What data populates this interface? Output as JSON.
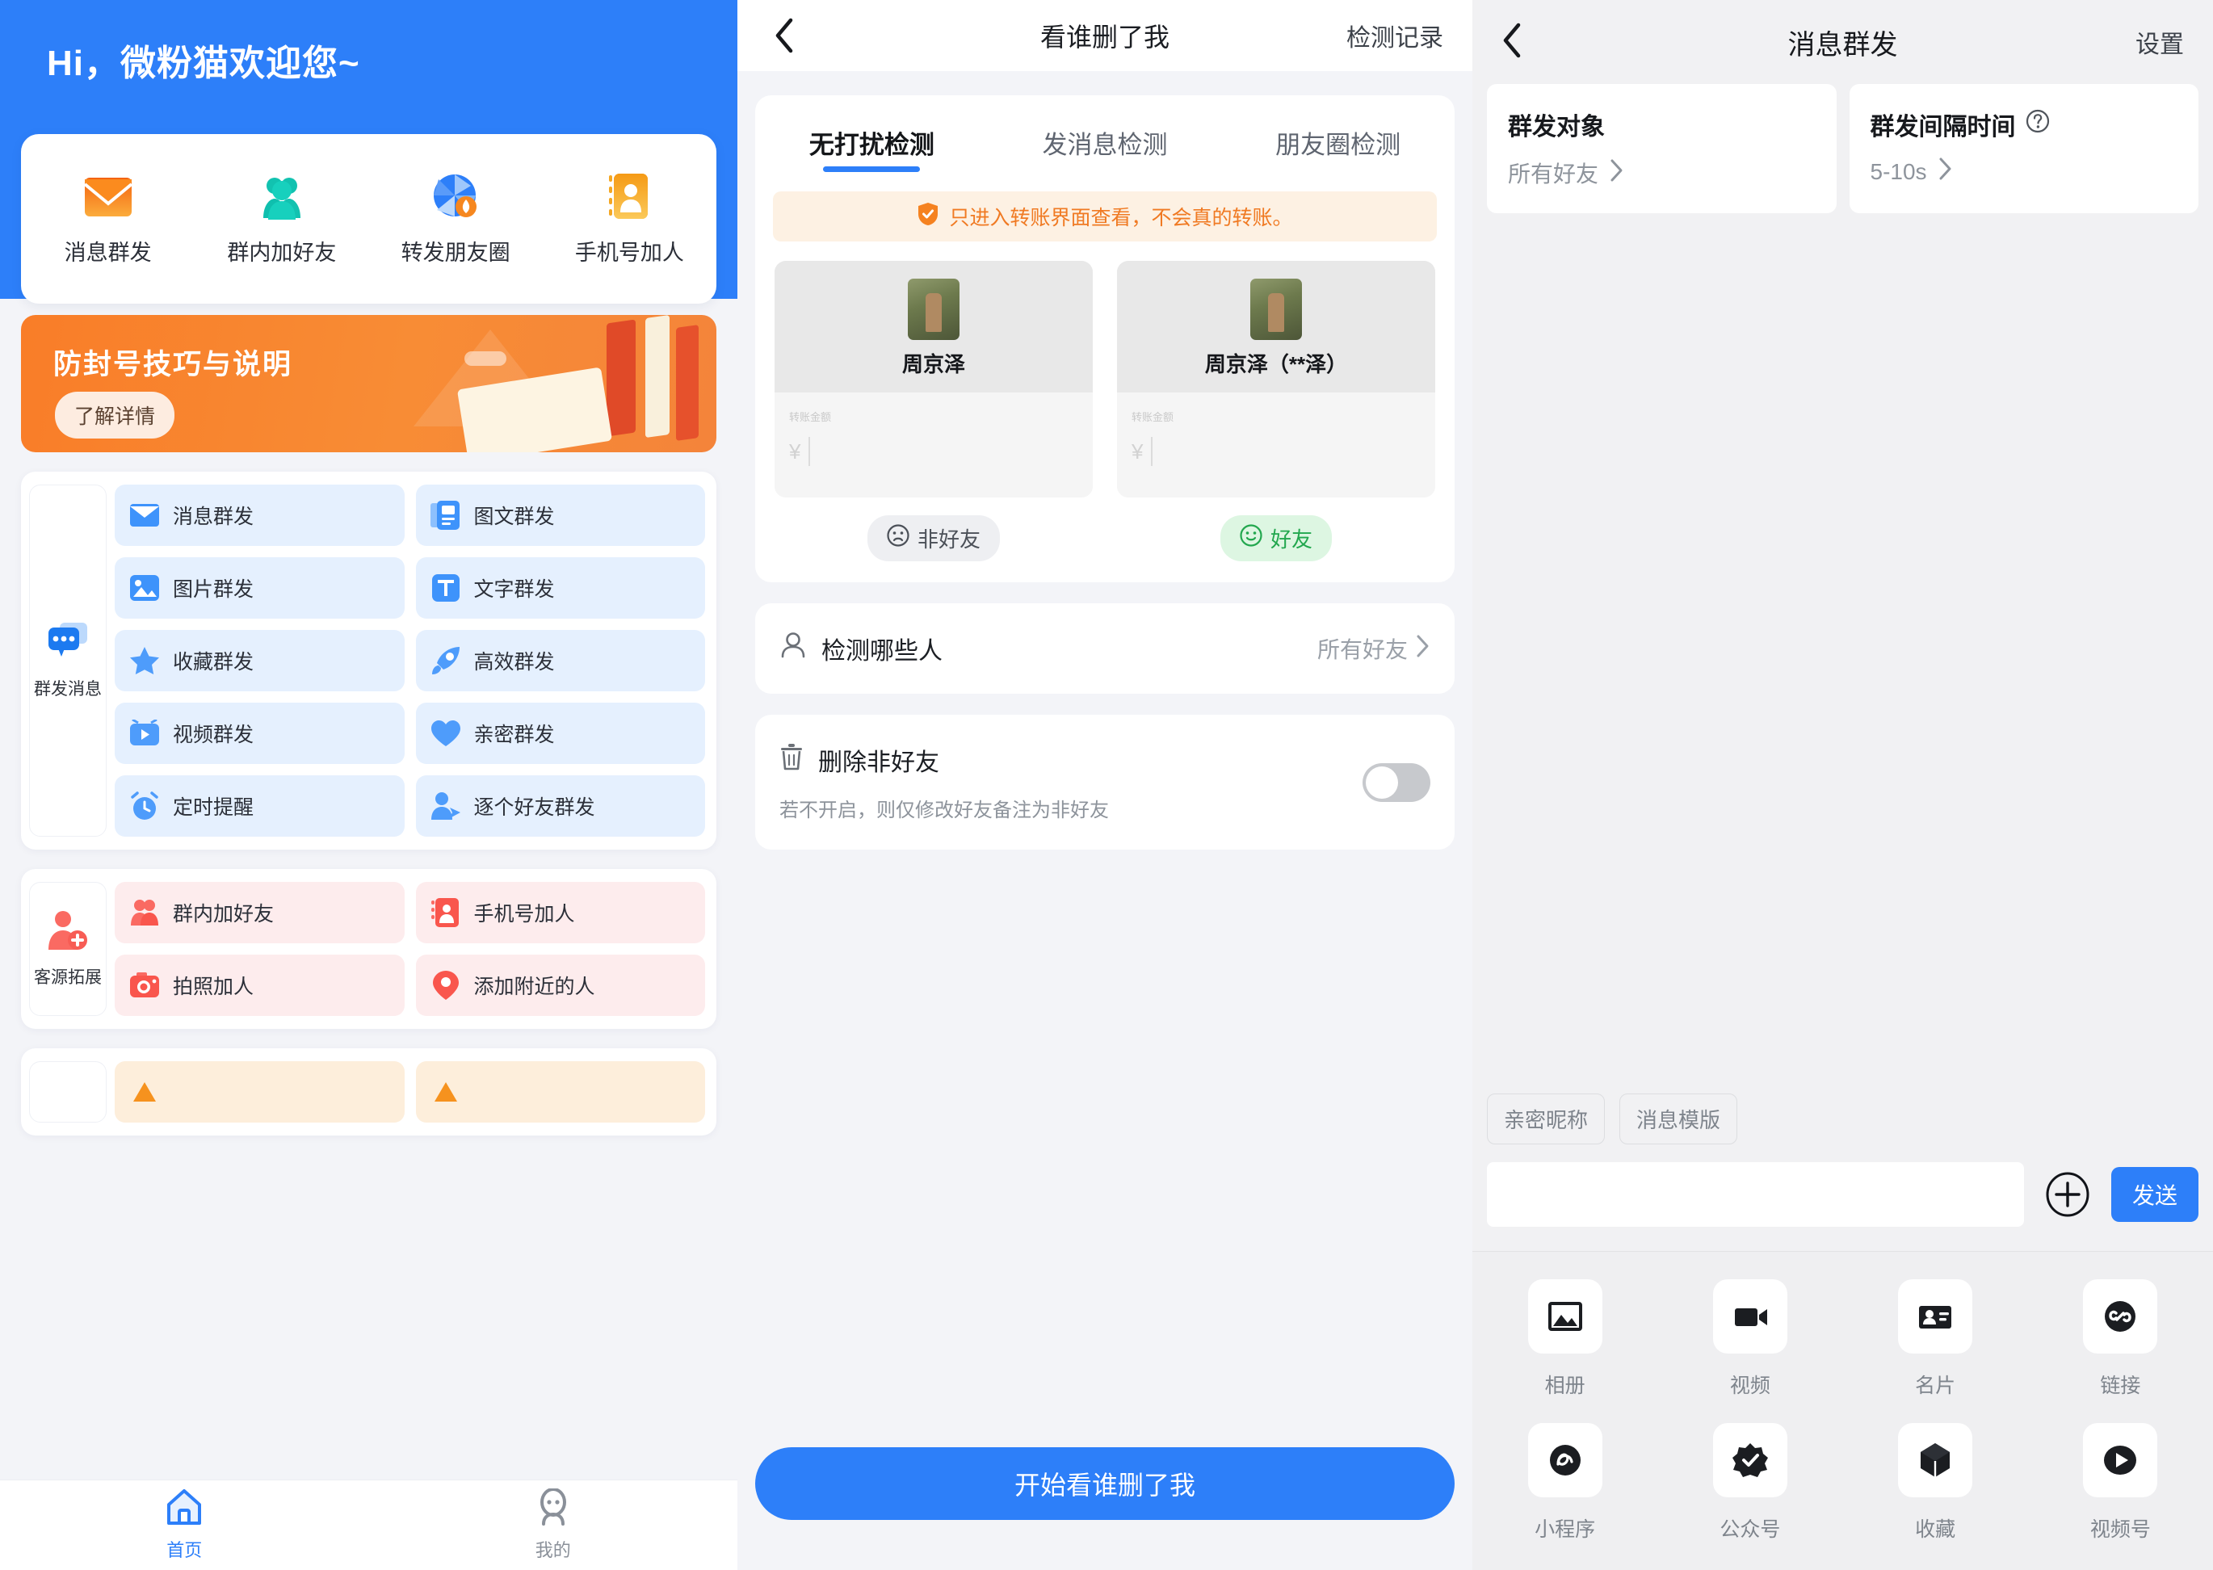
{
  "panel1": {
    "greeting": "Hi，微粉猫欢迎您~",
    "quick_actions": [
      {
        "label": "消息群发",
        "icon": "envelope-icon"
      },
      {
        "label": "群内加好友",
        "icon": "group-people-icon"
      },
      {
        "label": "转发朋友圈",
        "icon": "aperture-icon"
      },
      {
        "label": "手机号加人",
        "icon": "contact-book-icon"
      }
    ],
    "banner": {
      "title": "防封号技巧与说明",
      "button": "了解详情"
    },
    "sections": [
      {
        "side_label": "群发消息",
        "side_icon": "chat-bubbles-icon",
        "theme": "blue",
        "items": [
          {
            "label": "消息群发",
            "icon": "envelope-icon"
          },
          {
            "label": "图文群发",
            "icon": "image-text-icon"
          },
          {
            "label": "图片群发",
            "icon": "picture-icon"
          },
          {
            "label": "文字群发",
            "icon": "text-t-icon"
          },
          {
            "label": "收藏群发",
            "icon": "star-icon"
          },
          {
            "label": "高效群发",
            "icon": "rocket-icon"
          },
          {
            "label": "视频群发",
            "icon": "video-play-icon"
          },
          {
            "label": "亲密群发",
            "icon": "heart-icon"
          },
          {
            "label": "定时提醒",
            "icon": "alarm-clock-icon"
          },
          {
            "label": "逐个好友群发",
            "icon": "person-send-icon"
          }
        ]
      },
      {
        "side_label": "客源拓展",
        "side_icon": "person-add-icon",
        "theme": "red",
        "items": [
          {
            "label": "群内加好友",
            "icon": "group-people-icon"
          },
          {
            "label": "手机号加人",
            "icon": "contact-book-icon"
          },
          {
            "label": "拍照加人",
            "icon": "camera-icon"
          },
          {
            "label": "添加附近的人",
            "icon": "location-pin-icon"
          }
        ]
      },
      {
        "side_label": "",
        "side_icon": "",
        "theme": "orange",
        "items": [
          {
            "label": "",
            "icon": "warning-icon"
          },
          {
            "label": "",
            "icon": "warning-icon"
          }
        ]
      }
    ],
    "tabbar": [
      {
        "label": "首页",
        "icon": "home-icon",
        "active": true
      },
      {
        "label": "我的",
        "icon": "person-outline-icon",
        "active": false
      }
    ]
  },
  "panel2": {
    "nav": {
      "back_icon": "chevron-left-icon",
      "title": "看谁删了我",
      "right_label": "检测记录"
    },
    "tabs": [
      {
        "label": "无打扰检测",
        "selected": true
      },
      {
        "label": "发消息检测",
        "selected": false
      },
      {
        "label": "朋友圈检测",
        "selected": false
      }
    ],
    "notice": {
      "icon": "shield-check-icon",
      "text": "只进入转账界面查看，不会真的转账。"
    },
    "previews": [
      {
        "name": "周京泽",
        "amount_label": "转账金额",
        "currency": "¥",
        "badge": "非好友",
        "badge_icon": "sad-face-icon",
        "badge_type": "grey"
      },
      {
        "name": "周京泽（**泽）",
        "amount_label": "转账金额",
        "currency": "¥",
        "badge": "好友",
        "badge_icon": "smile-face-icon",
        "badge_type": "green"
      }
    ],
    "target_row": {
      "icon": "person-icon",
      "label": "检测哪些人",
      "value": "所有好友",
      "chevron": "chevron-right-icon"
    },
    "delete_row": {
      "icon": "trash-icon",
      "title": "删除非好友",
      "subtitle": "若不开启，则仅修改好友备注为非好友",
      "toggle_on": false
    },
    "cta": "开始看谁删了我"
  },
  "panel3": {
    "nav": {
      "back_icon": "chevron-left-icon",
      "title": "消息群发",
      "right_label": "设置"
    },
    "cards": [
      {
        "title": "群发对象",
        "value": "所有好友",
        "help_icon": "",
        "chevron": "chevron-right-icon"
      },
      {
        "title": "群发间隔时间",
        "value": "5-10s",
        "help_icon": "question-circle-icon",
        "chevron": "chevron-right-icon"
      }
    ],
    "chips": [
      "亲密昵称",
      "消息模版"
    ],
    "composer": {
      "input_value": "",
      "input_placeholder": "",
      "plus_icon": "plus-circle-icon",
      "send_label": "发送"
    },
    "attachments": [
      {
        "label": "相册",
        "icon": "photo-icon"
      },
      {
        "label": "视频",
        "icon": "video-camera-icon"
      },
      {
        "label": "名片",
        "icon": "id-card-icon"
      },
      {
        "label": "链接",
        "icon": "link-icon"
      },
      {
        "label": "小程序",
        "icon": "mini-program-icon"
      },
      {
        "label": "公众号",
        "icon": "official-account-icon"
      },
      {
        "label": "收藏",
        "icon": "favorites-box-icon"
      },
      {
        "label": "视频号",
        "icon": "channels-play-icon"
      }
    ]
  },
  "colors": {
    "brand_blue": "#2d7ff9",
    "banner_orange": "#f97d28",
    "friend_green": "#22a74e",
    "notice_orange": "#f07a23"
  }
}
